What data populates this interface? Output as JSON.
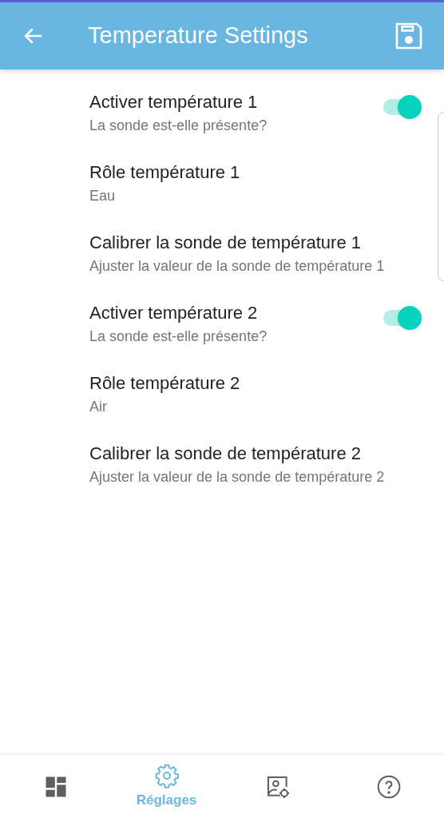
{
  "header": {
    "title": "Temperature Settings"
  },
  "settings": [
    {
      "kind": "switch",
      "title": "Activer température 1",
      "subtitle": "La sonde est-elle présente?",
      "on": true
    },
    {
      "kind": "value",
      "title": "Rôle température 1",
      "subtitle": "Eau"
    },
    {
      "kind": "value",
      "title": "Calibrer la sonde de température 1",
      "subtitle": "Ajuster la valeur de la sonde de température 1"
    },
    {
      "kind": "switch",
      "title": "Activer température 2",
      "subtitle": "La sonde est-elle présente?",
      "on": true
    },
    {
      "kind": "value",
      "title": "Rôle température 2",
      "subtitle": "Air"
    },
    {
      "kind": "value",
      "title": "Calibrer la sonde de température 2",
      "subtitle": "Ajuster la valeur de la sonde de température 2"
    }
  ],
  "nav": [
    {
      "kind": "dashboard",
      "selected": false
    },
    {
      "kind": "settings",
      "label": "Réglages",
      "selected": true
    },
    {
      "kind": "image-settings",
      "selected": false
    },
    {
      "kind": "help",
      "selected": false
    }
  ]
}
